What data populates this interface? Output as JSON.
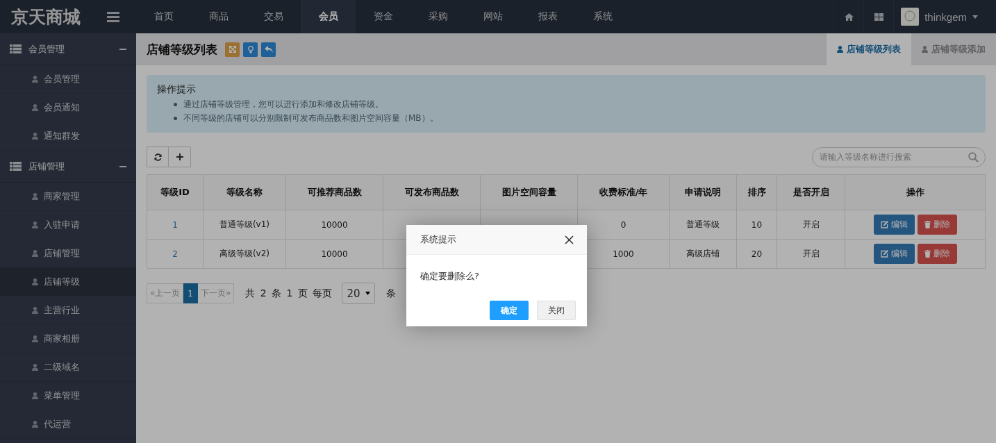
{
  "header": {
    "logo": "京天商城",
    "nav": [
      {
        "label": "首页",
        "selected": false
      },
      {
        "label": "商品",
        "selected": false
      },
      {
        "label": "交易",
        "selected": false
      },
      {
        "label": "会员",
        "selected": true
      },
      {
        "label": "资金",
        "selected": false
      },
      {
        "label": "采购",
        "selected": false
      },
      {
        "label": "网站",
        "selected": false
      },
      {
        "label": "报表",
        "selected": false
      },
      {
        "label": "系统",
        "selected": false
      }
    ],
    "user": "thinkgem"
  },
  "sidebar": [
    {
      "label": "会员管理",
      "expanded": true,
      "children": [
        {
          "label": "会员管理",
          "selected": false
        },
        {
          "label": "会员通知",
          "selected": false
        },
        {
          "label": "通知群发",
          "selected": false
        }
      ]
    },
    {
      "label": "店铺管理",
      "expanded": true,
      "children": [
        {
          "label": "商家管理",
          "selected": false
        },
        {
          "label": "入驻申请",
          "selected": false
        },
        {
          "label": "店铺管理",
          "selected": false
        },
        {
          "label": "店铺等级",
          "selected": true
        },
        {
          "label": "主营行业",
          "selected": false
        },
        {
          "label": "商家相册",
          "selected": false
        },
        {
          "label": "二级域名",
          "selected": false
        },
        {
          "label": "菜单管理",
          "selected": false
        },
        {
          "label": "代运营",
          "selected": false
        }
      ]
    }
  ],
  "page_title": "店铺等级列表",
  "tabs": [
    {
      "label": "店铺等级列表",
      "selected": true
    },
    {
      "label": "店铺等级添加",
      "selected": false
    }
  ],
  "tips": {
    "title": "操作提示",
    "items": [
      "通过店铺等级管理，您可以进行添加和修改店铺等级。",
      "不同等级的店铺可以分别限制可发布商品数和图片空间容量（MB）。"
    ]
  },
  "search": {
    "placeholder": "请输入等级名称进行搜索"
  },
  "table": {
    "columns": [
      "等级ID",
      "等级名称",
      "可推荐商品数",
      "可发布商品数",
      "图片空间容量",
      "收费标准/年",
      "申请说明",
      "排序",
      "是否开启",
      "操作"
    ],
    "rows": [
      {
        "id": "1",
        "name": "普通等级(v1)",
        "recommend": "10000",
        "fee": "0",
        "note": "普通等级",
        "sort": "10",
        "status": "开启",
        "actions": [
          {
            "kind": "edit",
            "label": "编辑"
          },
          {
            "kind": "delete",
            "label": "删除"
          }
        ]
      },
      {
        "id": "2",
        "name": "高级等级(v2)",
        "recommend": "10000",
        "fee": "1000",
        "note": "高级店铺",
        "sort": "20",
        "status": "开启",
        "actions": [
          {
            "kind": "edit",
            "label": "编辑"
          },
          {
            "kind": "delete",
            "label": "删除"
          }
        ]
      }
    ]
  },
  "pagination": {
    "prev": "«上一页",
    "pages": [
      {
        "label": "1",
        "selected": true
      }
    ],
    "next": "下一页»",
    "summary": "共 2 条 1 页 每页",
    "page_size": "20",
    "unit": "条"
  },
  "dialog": {
    "title": "系统提示",
    "message": "确定要删除么?",
    "buttons": [
      {
        "kind": "primary",
        "label": "确定"
      },
      {
        "kind": "default",
        "label": "关闭"
      }
    ]
  }
}
